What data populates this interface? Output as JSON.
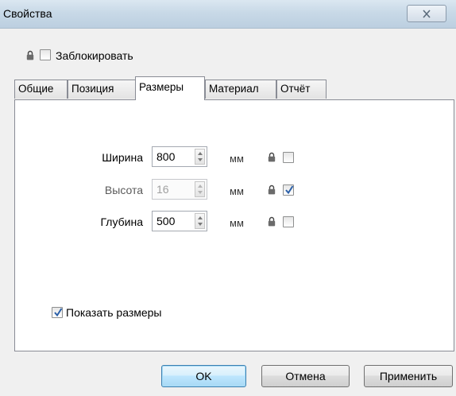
{
  "window": {
    "title": "Свойства",
    "close_label": "✕"
  },
  "lock_row": {
    "label": "Заблокировать",
    "checked": false
  },
  "tabs": [
    {
      "label": "Общие",
      "active": false
    },
    {
      "label": "Позиция",
      "active": false
    },
    {
      "label": "Размеры",
      "active": true
    },
    {
      "label": "Материал",
      "active": false
    },
    {
      "label": "Отчёт",
      "active": false
    }
  ],
  "dimensions": [
    {
      "label": "Ширина",
      "value": "800",
      "unit": "мм",
      "enabled": true,
      "locked": false
    },
    {
      "label": "Высота",
      "value": "16",
      "unit": "мм",
      "enabled": false,
      "locked": true
    },
    {
      "label": "Глубина",
      "value": "500",
      "unit": "мм",
      "enabled": true,
      "locked": false
    }
  ],
  "show_dimensions": {
    "label": "Показать размеры",
    "checked": true
  },
  "buttons": {
    "ok": "OK",
    "cancel": "Отмена",
    "apply": "Применить"
  },
  "icons": {
    "lock": "lock-icon",
    "check": "checkmark-icon",
    "close": "close-icon",
    "spin": "spin-arrows-icon"
  },
  "colors": {
    "title_bar": "#c8d9e7",
    "check_mark": "#2a5fa8",
    "panel_border": "#898c95"
  }
}
